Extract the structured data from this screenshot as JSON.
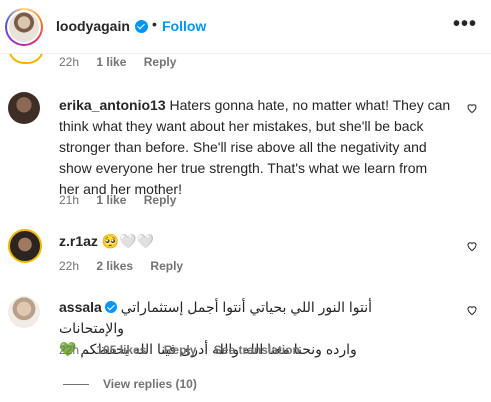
{
  "header": {
    "username": "loodyagain",
    "separator": "•",
    "follow_label": "Follow",
    "more_icon": "•••"
  },
  "previous_comment": {
    "time": "22h",
    "likes": "1 like",
    "reply": "Reply"
  },
  "comments": [
    {
      "username": "erika_antonio13",
      "text": "Haters gonna hate, no matter what! They can think what they want about her mistakes, but she'll be back stronger than before. She'll rise above all the negativity and show everyone her true strength. That's what we learn from her and her mother!",
      "time": "21h",
      "likes": "1 like",
      "reply": "Reply"
    },
    {
      "username": "z.r1az",
      "text": "🥺🤍🤍",
      "time": "22h",
      "likes": "2 likes",
      "reply": "Reply"
    },
    {
      "username": "assala",
      "verified": true,
      "text_line1": "أنتوا النور اللي بحياتي أنتوا أجمل إستثماراتي والإمتحانات",
      "text_line2": "وارده ونحنا معنا الله والله أدرى فينا الله يحفظكم 💚",
      "time": "22h",
      "likes": "105 likes",
      "reply": "Reply",
      "see_translation": "See translation"
    }
  ],
  "view_replies": "View replies (10)",
  "colors": {
    "accent": "#0095f6",
    "muted": "#737373",
    "text": "#262626"
  }
}
